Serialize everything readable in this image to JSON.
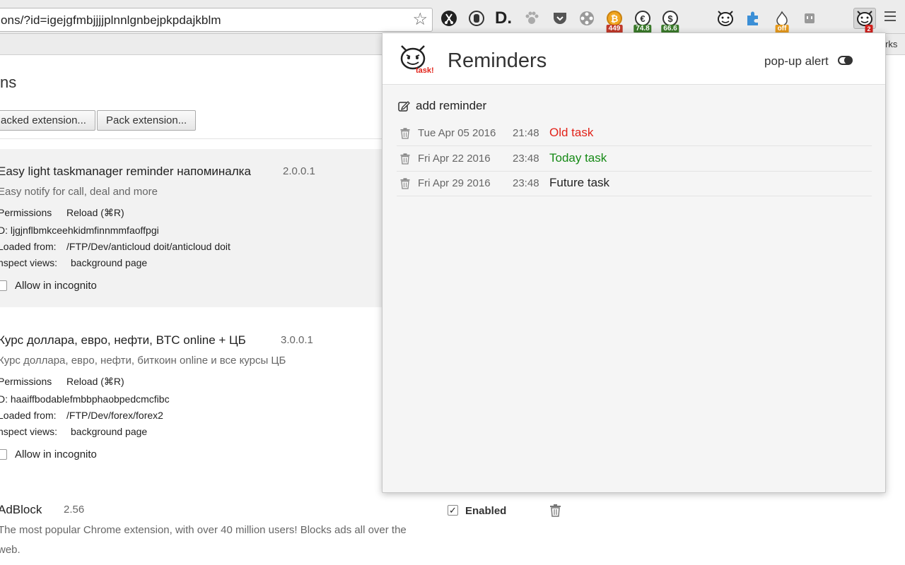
{
  "browser": {
    "url": "ons/?id=igejgfmbjjjjplnnlgnbejpkpdajkblm",
    "bookmarks_label": "rks",
    "badges": {
      "btc": "449",
      "eur": "74.8",
      "usd": "66.6",
      "off": "off",
      "task": "2"
    }
  },
  "page": {
    "title": "ns",
    "load_unpacked": "acked extension...",
    "pack_extension": "Pack extension..."
  },
  "extensions": [
    {
      "name": "Easy light taskmanager reminder напоминалка",
      "version": "2.0.0.1",
      "description": "Easy notify for call, deal and more",
      "permissions": "Permissions",
      "reload": "Reload (⌘R)",
      "id_line": "D: ljgjnflbmkceehkidmfinnmmfaoffpgi",
      "loaded_label": "Loaded from:",
      "loaded_path": "/FTP/Dev/anticloud doit/anticloud doit",
      "inspect_label": "nspect views:",
      "inspect_link": "background page",
      "incognito": "Allow in incognito"
    },
    {
      "name": "Курс доллара, евро, нефти, BTC online + ЦБ",
      "version": "3.0.0.1",
      "description": "Курс доллара, евро, нефти, биткоин online и все курсы ЦБ",
      "permissions": "Permissions",
      "reload": "Reload (⌘R)",
      "id_line": "D: haaiffbodablefmbbphaobpedcmcfibc",
      "loaded_label": "Loaded from:",
      "loaded_path": "/FTP/Dev/forex/forex2",
      "inspect_label": "nspect views:",
      "inspect_link": "background page",
      "incognito": "Allow in incognito"
    },
    {
      "name": "AdBlock",
      "version": "2.56",
      "description_line1": "The most popular Chrome extension, with over 40 million users! Blocks ads all over the",
      "description_line2": "web.",
      "enabled_label": "Enabled"
    }
  ],
  "popup": {
    "title": "Reminders",
    "logo_text": "task!",
    "popup_alert_label": "pop-up alert",
    "add_reminder_label": "add reminder",
    "reminders": [
      {
        "date": "Tue Apr 05 2016",
        "time": "21:48",
        "text": "Old task",
        "color": "#e2231a"
      },
      {
        "date": "Fri Apr 22 2016",
        "time": "23:48",
        "text": "Today task",
        "color": "#168a16"
      },
      {
        "date": "Fri Apr 29 2016",
        "time": "23:48",
        "text": "Future task",
        "color": "#222222"
      }
    ]
  },
  "colors": {
    "link": "#1155cc",
    "old_task": "#e2231a",
    "today_task": "#168a16"
  }
}
